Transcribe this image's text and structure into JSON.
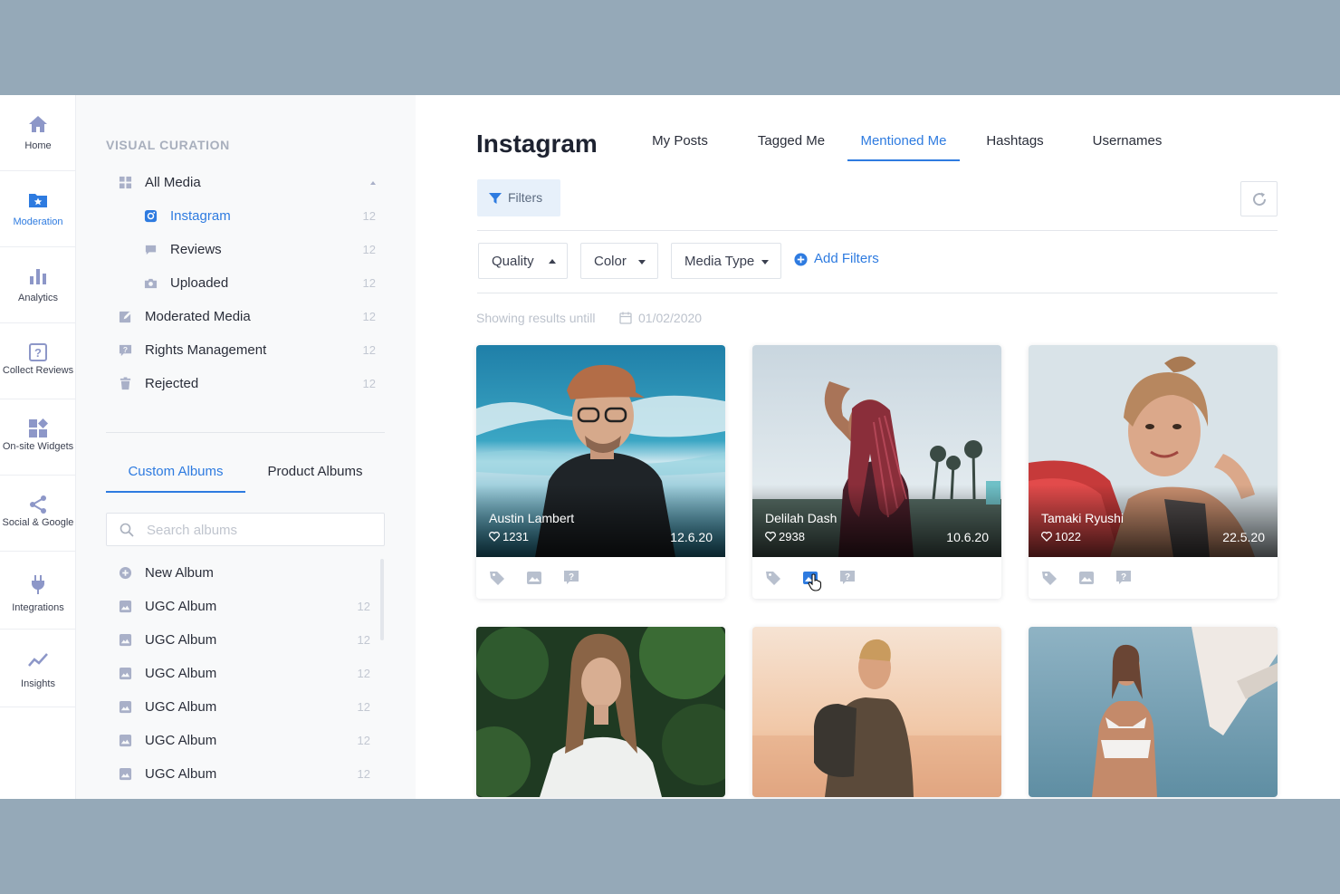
{
  "rail": [
    {
      "label": "Home",
      "icon": "home-icon"
    },
    {
      "label": "Moderation",
      "icon": "folder-star-icon",
      "active": true
    },
    {
      "label": "Analytics",
      "icon": "bar-chart-icon"
    },
    {
      "label": "Collect Reviews",
      "icon": "question-box-icon"
    },
    {
      "label": "On-site Widgets",
      "icon": "widgets-icon"
    },
    {
      "label": "Social & Google",
      "icon": "share-icon"
    },
    {
      "label": "Integrations",
      "icon": "plug-icon"
    },
    {
      "label": "Insights",
      "icon": "trend-line-icon"
    }
  ],
  "panel": {
    "section_title": "VISUAL CURATION",
    "nav": [
      {
        "label": "All Media",
        "count": "",
        "icon": "grid-icon"
      },
      {
        "label": "Instagram",
        "count": "12",
        "icon": "instagram-icon"
      },
      {
        "label": "Reviews",
        "count": "12",
        "icon": "chat-bubble-icon"
      },
      {
        "label": "Uploaded",
        "count": "12",
        "icon": "camera-icon"
      },
      {
        "label": "Moderated Media",
        "count": "12",
        "icon": "edit-icon"
      },
      {
        "label": "Rights Management",
        "count": "12",
        "icon": "question-icon"
      },
      {
        "label": "Rejected",
        "count": "12",
        "icon": "trash-icon"
      }
    ],
    "album_tabs": [
      "Custom Albums",
      "Product Albums"
    ],
    "search_placeholder": "Search albums",
    "albums": [
      {
        "label": "New Album",
        "count": "",
        "icon": "plus-circle-icon"
      },
      {
        "label": "UGC Album",
        "count": "12",
        "icon": "image-icon"
      },
      {
        "label": "UGC Album",
        "count": "12",
        "icon": "image-icon"
      },
      {
        "label": "UGC Album",
        "count": "12",
        "icon": "image-icon"
      },
      {
        "label": "UGC Album",
        "count": "12",
        "icon": "image-icon"
      },
      {
        "label": "UGC Album",
        "count": "12",
        "icon": "image-icon"
      },
      {
        "label": "UGC Album",
        "count": "12",
        "icon": "image-icon"
      }
    ]
  },
  "main": {
    "title": "Instagram",
    "tabs": [
      "My Posts",
      "Tagged Me",
      "Mentioned Me",
      "Hashtags",
      "Usernames"
    ],
    "active_tab": "Mentioned Me",
    "filters_label": "Filters",
    "dropdowns": [
      "Quality",
      "Color",
      "Media Type"
    ],
    "add_filters": "Add Filters",
    "showing_text": "Showing results untill",
    "showing_date": "01/02/2020",
    "cards": [
      {
        "name": "Austin Lambert",
        "likes": "1231",
        "date": "12.6.20"
      },
      {
        "name": "Delilah Dash",
        "likes": "2938",
        "date": "10.6.20"
      },
      {
        "name": "Tamaki Ryushi",
        "likes": "1022",
        "date": "22.5.20"
      }
    ]
  },
  "colors": {
    "accent": "#2e7be0",
    "rail_icon": "#8d97c8",
    "panel_bg": "#f8f9fa",
    "frame": "#95a9b8"
  }
}
